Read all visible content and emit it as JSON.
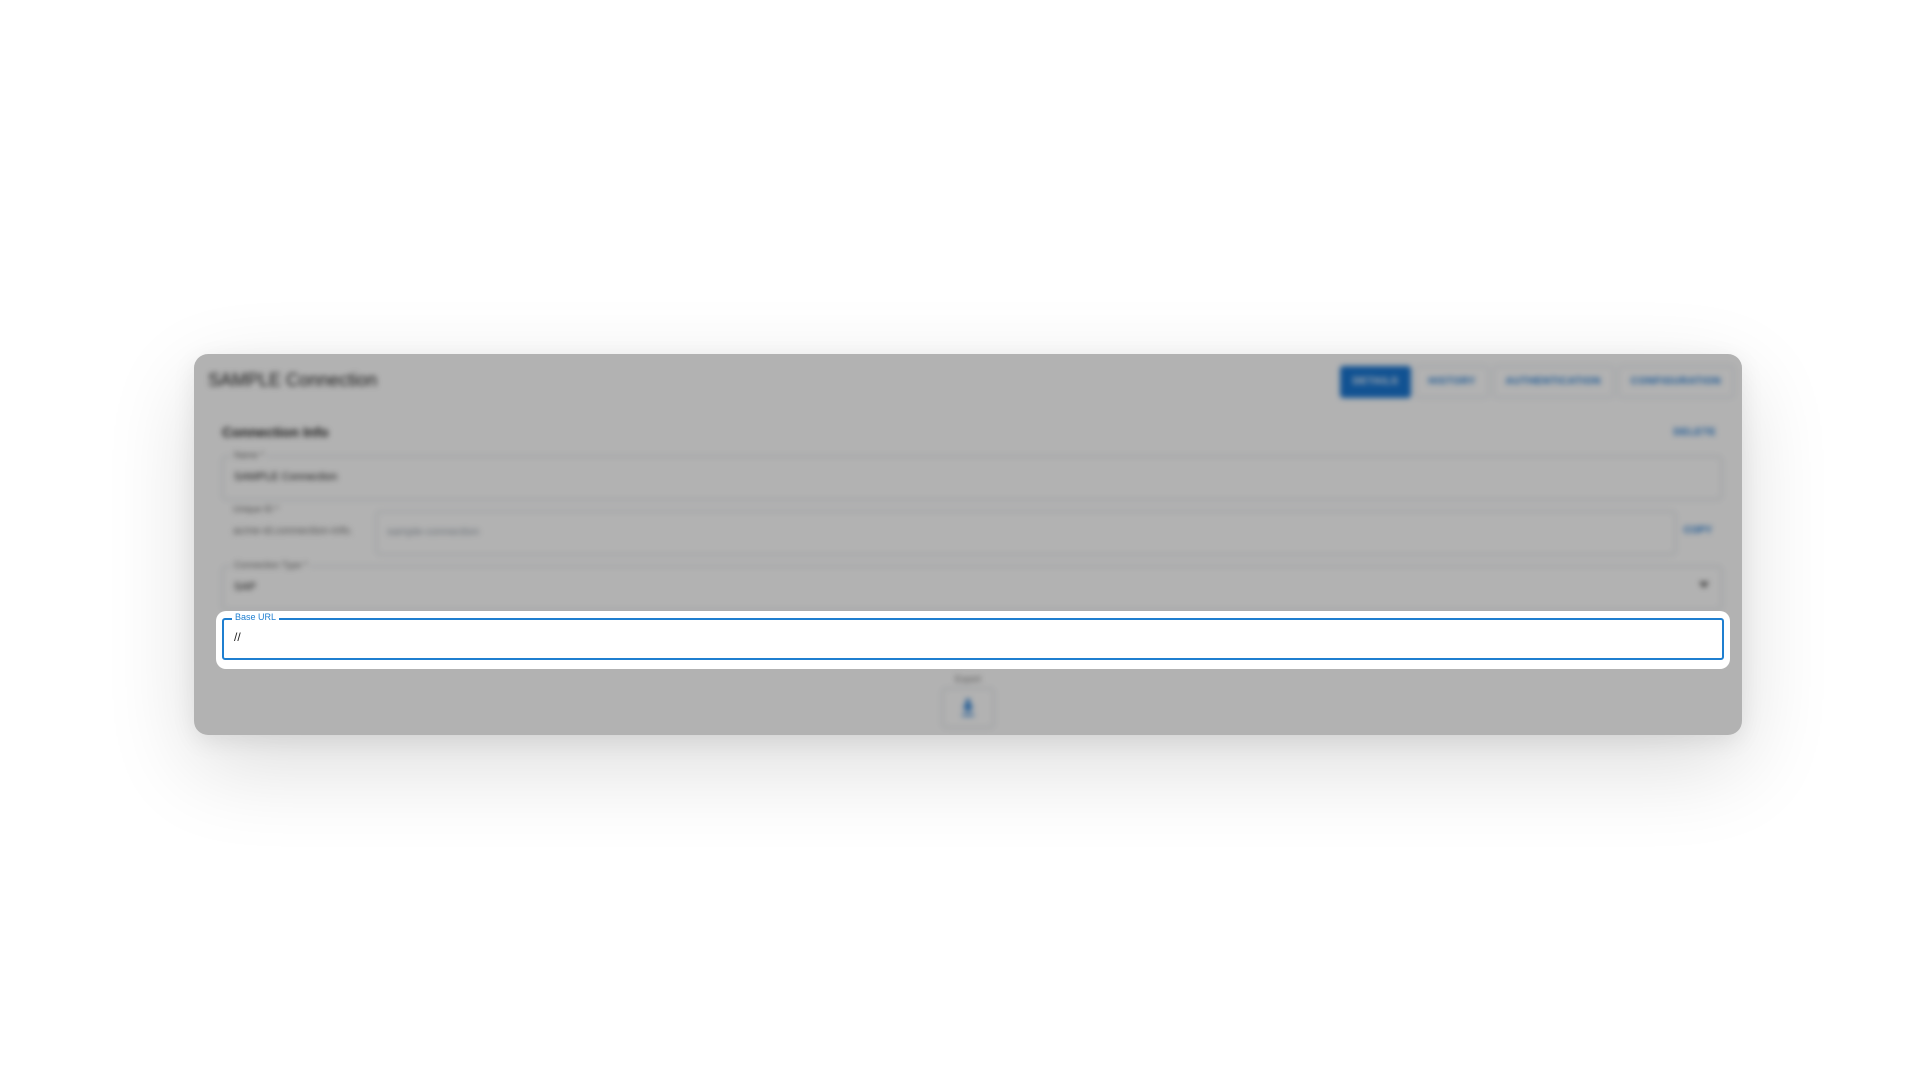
{
  "dialog": {
    "title": "SAMPLE Connection",
    "tabs": [
      {
        "label": "DETAILS",
        "active": true
      },
      {
        "label": "HISTORY",
        "active": false
      },
      {
        "label": "AUTHENTICATION",
        "active": false
      },
      {
        "label": "CONFIGURATION",
        "active": false
      }
    ]
  },
  "section": {
    "title": "Connection Info",
    "delete_label": "DELETE"
  },
  "fields": {
    "name": {
      "label": "Name *",
      "value": "SAMPLE Connection"
    },
    "unique_id": {
      "label": "Unique ID *",
      "prefix": "acme-id.connection-info.",
      "placeholder": "sample-connection",
      "copy_label": "COPY"
    },
    "connection_type": {
      "label": "Connection Type *",
      "value": "SAP"
    },
    "base_url": {
      "label": "Base URL",
      "value": "//"
    }
  },
  "export": {
    "label": "Export",
    "icon": "download-icon"
  },
  "colors": {
    "accent": "#1976d2",
    "focus": "#1f7fd0"
  }
}
